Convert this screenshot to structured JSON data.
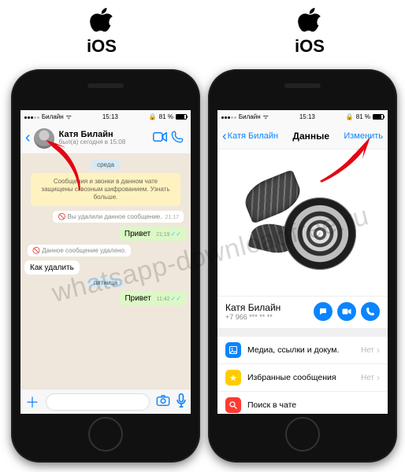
{
  "labels": {
    "ios": "iOS"
  },
  "statusbar": {
    "carrier": "Билайн",
    "wifi": "ᯤ",
    "time": "15:13",
    "lock": "🔒",
    "battery_pct": "81 %"
  },
  "chat": {
    "header": {
      "name": "Катя Билайн",
      "subtitle": "был(а) сегодня в 15:08"
    },
    "dates": {
      "wed": "среда",
      "fri": "пятница"
    },
    "encryption_banner": "Сообщения и звонки в данном чате защищены сквозным шифрованием. Узнать больше.",
    "deleted_you": "Вы удалили данное сообщение.",
    "deleted_other": "Данное сообщение удалено.",
    "times": {
      "t1": "21:17",
      "t2": "21:19",
      "t3": "11:42"
    },
    "msgs": {
      "hello": "Привет",
      "howdel": "Как удалить"
    }
  },
  "info": {
    "back_label": "Катя Билайн",
    "title": "Данные",
    "edit": "Изменить",
    "contact_name": "Катя Билайн",
    "contact_phone": "+7 966 *** ** **",
    "items": {
      "media": "Медиа, ссылки и докум.",
      "fav": "Избранные сообщения",
      "search": "Поиск в чате"
    },
    "none": "Нет"
  },
  "watermark": "whatsapp-downloadfree.ru"
}
